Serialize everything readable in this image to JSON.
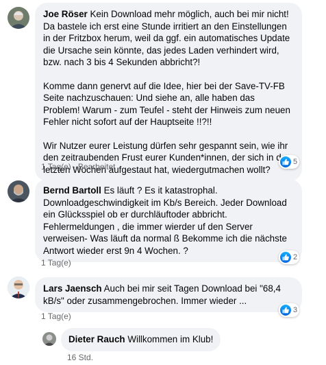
{
  "comments": [
    {
      "author": "Joe Röser",
      "paragraphs": [
        "Kein Download mehr möglich, auch bei mir nicht! Da bastele ich erst eine Stunde irritiert an den Einstellungen in der Fritzbox herum, weil da ggf. ein automatisches Update die Ursache sein könnte, das jedes Laden verhindert wird, bzw. nach 3 bis 4 Sekunden abbricht?!",
        "Komme dann genervt auf die Idee, hier bei der Save-TV-FB Seite nachzuschauen: Und siehe an, alle haben das Problem! Warum - zum Teufel - steht der Hinweis zum neuen Fehler nicht sofort auf der Hauptseite !!?!!",
        "Wir Nutzer eurer Leistung dürfen sehr gespannt sein, wie ihr den zeitraubenden Frust eurer Kunden*innen, der sich in den letzten Wochen aufgestaut hat, wiedergutmachen wollt?"
      ],
      "time": "1 Tag(e)",
      "edited": "Bearbeitet",
      "reactions": "5"
    },
    {
      "author": "Bernd Bartoll",
      "paragraphs": [
        "Es läuft ? Es it katastrophal. Downloadgeschwindigkeit im Kb/s Bereich. Jeder Download ein Glücksspiel ob er durchläuftoder abbricht. Fehlermeldungen , die immer wierder uf den Server verweisen- Was läuft da normal ß Bekomme ich die nächste Antwort wieder erst 9n 4 Wochen. ?"
      ],
      "time": "1 Tag(e)",
      "reactions": "2"
    },
    {
      "author": "Lars Jaensch",
      "paragraphs": [
        "Auch bei mir seit Tagen Download bei \"68,4 kB/s\" oder zusammengebrochen. Immer wieder ..."
      ],
      "time": "1 Tag(e)",
      "reactions": "3"
    }
  ],
  "reply": {
    "author": "Dieter Rauch",
    "text": "Willkommen im Klub!",
    "time": "16 Std."
  },
  "colors": {
    "bubble": "#f0f2f5",
    "meta": "#65676b",
    "like": "#1877f2"
  },
  "icons": {
    "reaction": "like-icon"
  }
}
